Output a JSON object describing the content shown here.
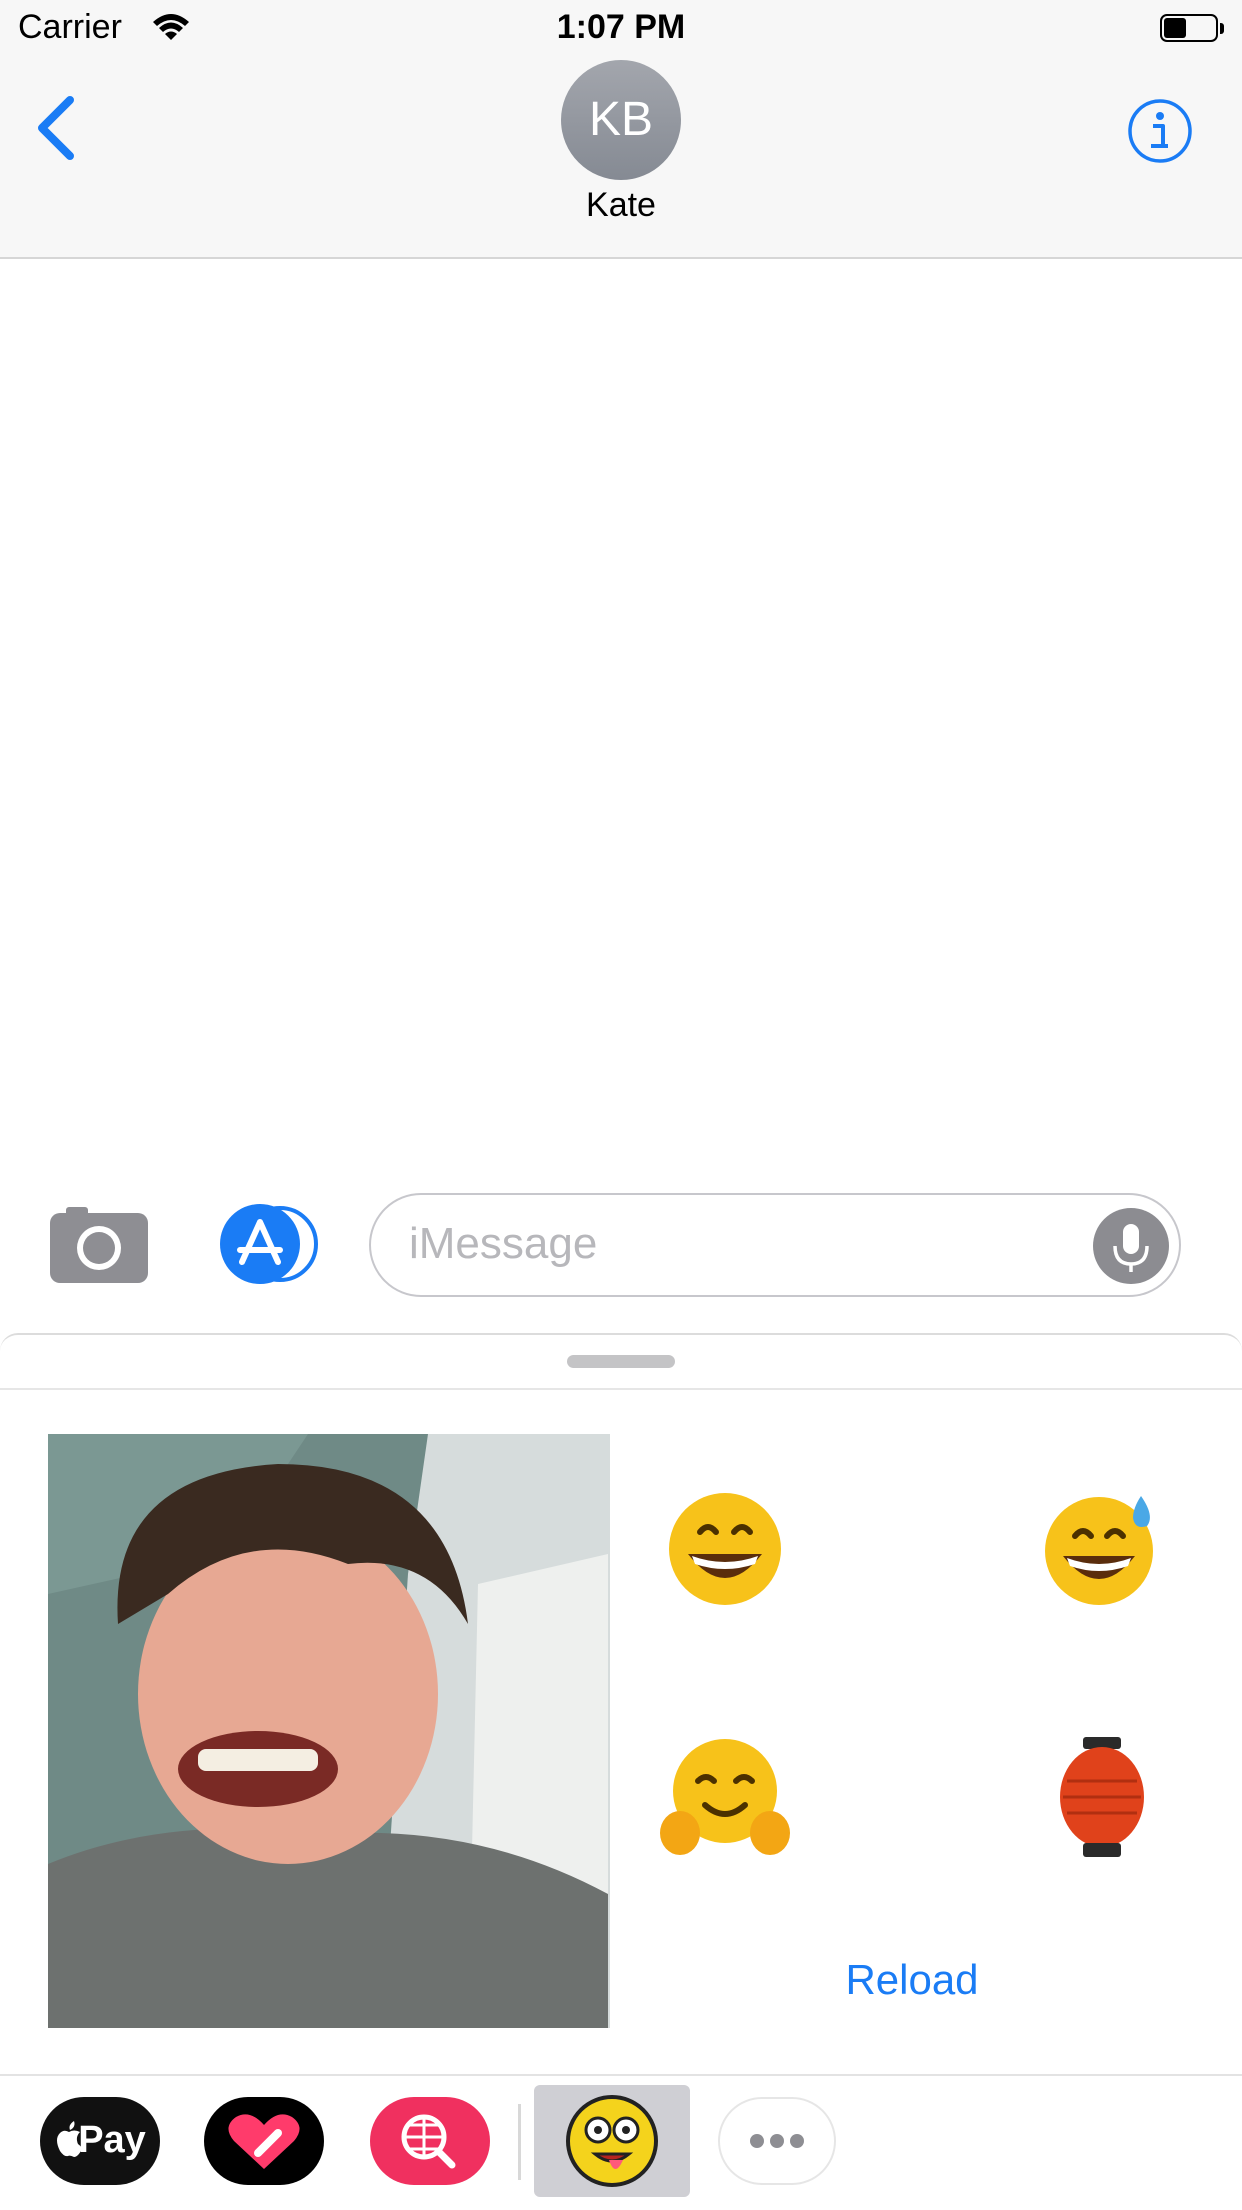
{
  "status_bar": {
    "carrier": "Carrier",
    "time": "1:07 PM"
  },
  "header": {
    "avatar_initials": "KB",
    "contact_name": "Kate"
  },
  "compose": {
    "placeholder": "iMessage"
  },
  "drawer": {
    "stickers": [
      "grinning-face",
      "grinning-face-with-sweat",
      "hugging-face",
      "red-paper-lantern"
    ],
    "reload_label": "Reload"
  },
  "app_tray": {
    "pay_label": "Pay",
    "items": [
      "apple-pay",
      "digital-touch",
      "images-search",
      "emoji-stickers-app",
      "more"
    ]
  },
  "colors": {
    "accent": "#1a7cf5",
    "nav_background": "#f7f7f7",
    "avatar_gray": "#8e929a",
    "search_app_pink": "#f0305f"
  }
}
